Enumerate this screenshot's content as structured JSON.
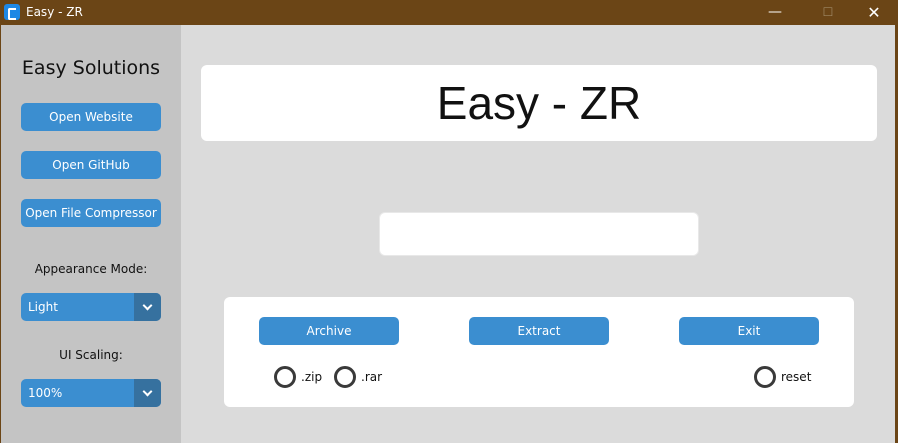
{
  "window": {
    "title": "Easy - ZR",
    "minimize_glyph": "—",
    "maximize_glyph": "☐",
    "close_glyph": "✕",
    "icon": "app-icon"
  },
  "sidebar": {
    "logo": "Easy Solutions",
    "buttons": [
      "Open Website",
      "Open GitHub",
      "Open File Compressor"
    ],
    "appearance_label": "Appearance Mode:",
    "appearance_value": "Light",
    "scaling_label": "UI Scaling:",
    "scaling_value": "100%"
  },
  "main": {
    "title": "Easy - ZR",
    "entry_value": "",
    "actions": {
      "archive": "Archive",
      "extract": "Extract",
      "exit": "Exit"
    },
    "radios": {
      "zip": ".zip",
      "rar": ".rar",
      "reset": "reset"
    }
  },
  "colors": {
    "accent": "#3b8ed0",
    "accent_dark": "#36719f",
    "titlebar": "#6b4516",
    "sidebar_bg": "#c4c4c4",
    "main_bg": "#dbdbdb"
  }
}
